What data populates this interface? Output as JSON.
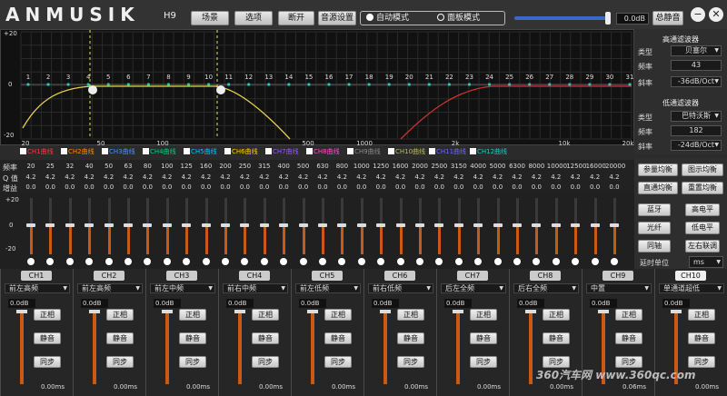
{
  "header": {
    "logo": "ANMUSIK",
    "model": "H9",
    "buttons": [
      "场景",
      "选项",
      "断开",
      "音源设置"
    ],
    "mode_auto": "自动模式",
    "mode_panel": "面板模式",
    "volume_value": "0.0dB",
    "volume_level": 1.0,
    "mute_all": "总静音",
    "minimize": "−",
    "close": "✕"
  },
  "graph": {
    "y_top": "+20",
    "y_mid": "0",
    "y_bottom": "-20",
    "band_numbers": [
      "1",
      "2",
      "3",
      "4",
      "5",
      "6",
      "7",
      "8",
      "9",
      "10",
      "11",
      "12",
      "13",
      "14",
      "15",
      "16",
      "17",
      "18",
      "19",
      "20",
      "21",
      "22",
      "23",
      "24",
      "25",
      "26",
      "27",
      "28",
      "29",
      "30",
      "31"
    ],
    "x_ticks": [
      "20",
      "50",
      "100",
      "500",
      "1000",
      "2k",
      "10k",
      "20k"
    ],
    "legend": [
      "CH1曲线",
      "CH2曲线",
      "CH3曲线",
      "CH4曲线",
      "CH5曲线",
      "CH6曲线",
      "CH7曲线",
      "CH8曲线",
      "CH9曲线",
      "CH10曲线",
      "CH11曲线",
      "CH12曲线"
    ],
    "legend_colors": [
      "#ff3b3b",
      "#ff8c00",
      "#4a90ff",
      "#00d27a",
      "#00c8ff",
      "#ffd400",
      "#9b59ff",
      "#ff4fd8",
      "#8a8a8a",
      "#bcbc6a",
      "#6a6aff",
      "#22c9c9"
    ]
  },
  "filters": {
    "highpass_title": "高通滤波器",
    "highpass_type_label": "类型",
    "highpass_type": "贝塞尔",
    "highpass_freq_label": "频率",
    "highpass_freq": "43",
    "highpass_slope_label": "斜率",
    "highpass_slope": "-36dB/Oct",
    "lowpass_title": "低通滤波器",
    "lowpass_type_label": "类型",
    "lowpass_type": "巴特沃斯",
    "lowpass_freq_label": "频率",
    "lowpass_freq": "182",
    "lowpass_slope_label": "斜率",
    "lowpass_slope": "-24dB/Oct"
  },
  "bands": {
    "freq_label": "频率",
    "q_label": "Q 值",
    "gain_label": "增益",
    "freqs": [
      "20",
      "25",
      "32",
      "40",
      "50",
      "63",
      "80",
      "100",
      "125",
      "160",
      "200",
      "250",
      "315",
      "400",
      "500",
      "630",
      "800",
      "1000",
      "1250",
      "1600",
      "2000",
      "2500",
      "3150",
      "4000",
      "5000",
      "6300",
      "8000",
      "10000",
      "12500",
      "16000",
      "20000"
    ],
    "q": "4.2",
    "gain": "0.0",
    "slider_top": "+20",
    "slider_mid": "0",
    "slider_bottom": "-20"
  },
  "right_buttons": {
    "param_eq": "参量均衡",
    "graphic_eq": "图示均衡",
    "bypass_eq": "直通均衡",
    "reset_eq": "重置均衡",
    "bluetooth": "蓝牙",
    "high_level": "高电平",
    "optical": "光纤",
    "low_level": "低电平",
    "coaxial": "同轴",
    "lr_link": "左右联调",
    "delay_unit_label": "延时单位",
    "delay_unit": "ms"
  },
  "channels": [
    {
      "tab": "CH1",
      "source": "前左高频",
      "db": "0.0dB",
      "phase": "正相",
      "mute": "静音",
      "sync": "同步",
      "delay": "0.00ms"
    },
    {
      "tab": "CH2",
      "source": "前左高频",
      "db": "0.0dB",
      "phase": "正相",
      "mute": "静音",
      "sync": "同步",
      "delay": "0.00ms"
    },
    {
      "tab": "CH3",
      "source": "前左中频",
      "db": "0.0dB",
      "phase": "正相",
      "mute": "静音",
      "sync": "同步",
      "delay": "0.00ms"
    },
    {
      "tab": "CH4",
      "source": "前右中频",
      "db": "0.0dB",
      "phase": "正相",
      "mute": "静音",
      "sync": "同步",
      "delay": "0.00ms"
    },
    {
      "tab": "CH5",
      "source": "前左低频",
      "db": "0.0dB",
      "phase": "正相",
      "mute": "静音",
      "sync": "同步",
      "delay": "0.00ms"
    },
    {
      "tab": "CH6",
      "source": "前右低频",
      "db": "0.0dB",
      "phase": "正相",
      "mute": "静音",
      "sync": "同步",
      "delay": "0.00ms"
    },
    {
      "tab": "CH7",
      "source": "后左全频",
      "db": "0.0dB",
      "phase": "正相",
      "mute": "静音",
      "sync": "同步",
      "delay": "0.00ms"
    },
    {
      "tab": "CH8",
      "source": "后右全频",
      "db": "0.0dB",
      "phase": "正相",
      "mute": "静音",
      "sync": "同步",
      "delay": "0.00ms"
    },
    {
      "tab": "CH9",
      "source": "中置",
      "db": "0.0dB",
      "phase": "正相",
      "mute": "静音",
      "sync": "同步",
      "delay": "0.06ms"
    },
    {
      "tab": "CH10",
      "source": "单通道超低",
      "db": "0.0dB",
      "phase": "正相",
      "mute": "静音",
      "sync": "同步",
      "delay": "0.00ms"
    }
  ],
  "watermark": "360汽车网 www.360qc.com",
  "colors": {
    "accent_orange": "#c85a16",
    "curve_yellow": "#e6d04a",
    "curve_red": "#c83232",
    "slider_blue": "#3b67c9"
  }
}
